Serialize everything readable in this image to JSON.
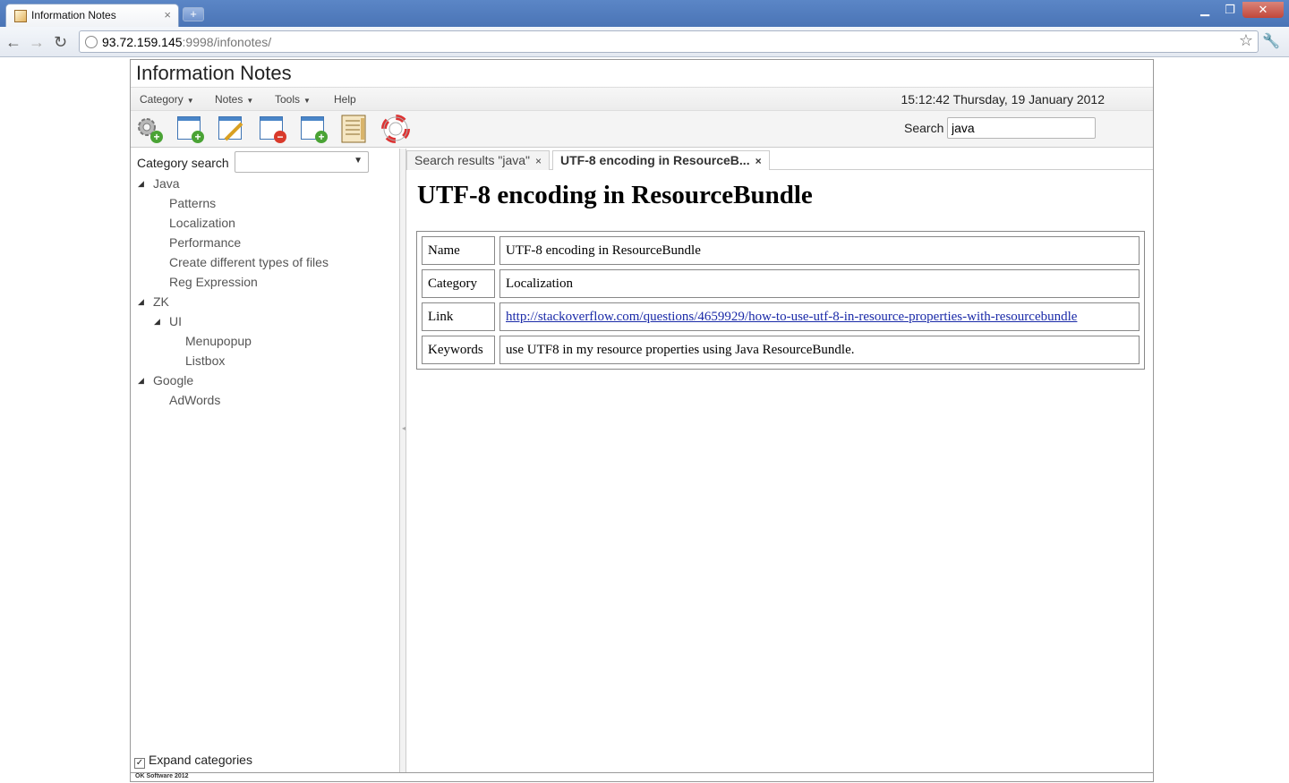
{
  "browser": {
    "tab_title": "Information Notes",
    "tab_close": "×",
    "new_tab": "+",
    "url_host": "93.72.159.145",
    "url_rest": ":9998/infonotes/",
    "win_min": "▁",
    "win_max": "❐",
    "win_close": "✕",
    "back": "←",
    "forward": "→",
    "reload": "↻",
    "star": "☆",
    "wrench": "🔧"
  },
  "app": {
    "title": "Information Notes",
    "menu": [
      "Category",
      "Notes",
      "Tools",
      "Help"
    ],
    "clock": "15:12:42 Thursday, 19 January 2012",
    "search_label": "Search",
    "search_value": "java",
    "toolbar_icons": [
      "settings-add-icon",
      "new-note-icon",
      "edit-note-icon",
      "delete-note-icon",
      "add-category-icon",
      "notes-list-icon",
      "help-lifebuoy-icon"
    ]
  },
  "left": {
    "category_search_label": "Category search",
    "category_search_value": "",
    "tree": [
      {
        "label": "Java",
        "level": 0,
        "toggle": "◢"
      },
      {
        "label": "Patterns",
        "level": 1
      },
      {
        "label": "Localization",
        "level": 1
      },
      {
        "label": "Performance",
        "level": 1
      },
      {
        "label": "Create different types of files",
        "level": 1
      },
      {
        "label": "Reg Expression",
        "level": 1
      },
      {
        "label": "ZK",
        "level": 0,
        "toggle": "◢"
      },
      {
        "label": "UI",
        "level": 1,
        "toggle": "◢"
      },
      {
        "label": "Menupopup",
        "level": 2
      },
      {
        "label": "Listbox",
        "level": 2
      },
      {
        "label": "Google",
        "level": 0,
        "toggle": "◢"
      },
      {
        "label": "AdWords",
        "level": 1
      }
    ],
    "expand_label": "Expand categories",
    "expand_checked": "✓"
  },
  "right": {
    "tabs": [
      {
        "label": "Search results \"java\"",
        "close": "×"
      },
      {
        "label": "UTF-8 encoding in ResourceB...",
        "close": "×"
      }
    ],
    "heading": "UTF-8 encoding in ResourceBundle",
    "rows": [
      {
        "key": "Name",
        "value": "UTF-8 encoding in ResourceBundle"
      },
      {
        "key": "Category",
        "value": "Localization"
      },
      {
        "key": "Link",
        "value": "http://stackoverflow.com/questions/4659929/how-to-use-utf-8-in-resource-properties-with-resourcebundle"
      },
      {
        "key": "Keywords",
        "value": "use UTF8 in my resource properties using Java ResourceBundle."
      }
    ]
  },
  "footer": "OK Software 2012"
}
